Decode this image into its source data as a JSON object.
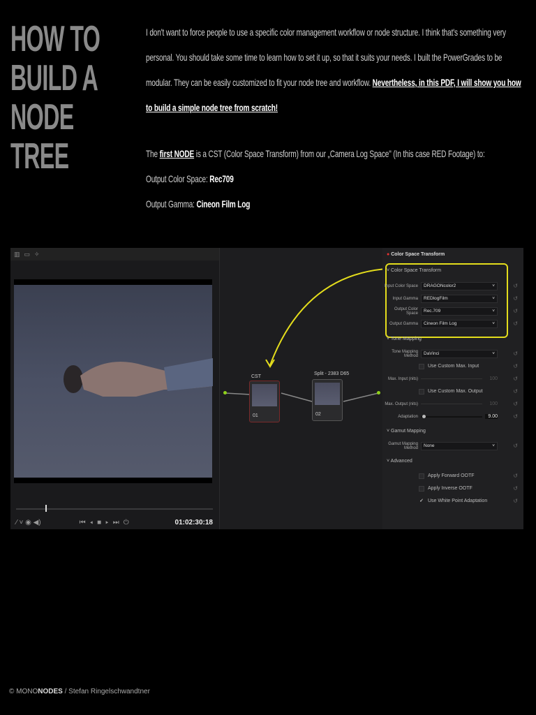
{
  "title": {
    "line1": "HOW TO BUILD A",
    "line2": "NODE TREE"
  },
  "intro": {
    "text": "I don't want to force people to use a specific color management workflow or node structure. I think that's something very personal. You should take some time to learn how to set it up, so that it suits your needs. I built the PowerGrades to be modular. They can be easily customized to fit your node tree and workflow. ",
    "emph": "Nevertheless, in this PDF, I will show you how to build a simple node tree from scratch!"
  },
  "cst": {
    "pre": "The ",
    "link": "first NODE",
    "post": " is a CST (Color Space Transform) from our „Camera Log Space\" (In this case RED Footage) to:",
    "ocs_label": "Output Color Space: ",
    "ocs_value": "Rec709",
    "og_label": "Output Gamma: ",
    "og_value": "Cineon Film Log"
  },
  "viewer": {
    "timecode": "01:02:30:18",
    "playhead": 0.15
  },
  "nodes": [
    {
      "title": "CST",
      "label": "01"
    },
    {
      "title": "Split - 2383 D65",
      "label": "02"
    }
  ],
  "inspector": {
    "header": "Color Space Transform",
    "sections": {
      "cst": "Color Space Transform",
      "tone": "Tone Mapping",
      "gamut": "Gamut Mapping",
      "adv": "Advanced"
    },
    "fields": [
      {
        "label": "Input Color Space",
        "value": "DRAGONcolor2"
      },
      {
        "label": "Input Gamma",
        "value": "REDlogFilm"
      },
      {
        "label": "Output Color Space",
        "value": "Rec.709"
      },
      {
        "label": "Output Gamma",
        "value": "Cineon Film Log"
      }
    ],
    "tone_method_label": "Tone Mapping Method",
    "tone_method": "DaVinci",
    "custom_in": "Use Custom Max. Input",
    "max_in_label": "Max. Input (nits)",
    "max_in": "100",
    "custom_out": "Use Custom Max. Output",
    "max_out_label": "Max. Output (nits)",
    "max_out": "100",
    "adapt_label": "Adaptation",
    "adapt": "9.00",
    "gamut_label": "Gamut Mapping Method",
    "gamut": "None",
    "fwd": "Apply Forward OOTF",
    "inv": "Apply Inverse OOTF",
    "wpa": "Use White Point Adaptation",
    "wpa_checked": true,
    "highlight_color": "#e4dd1c"
  },
  "footer": {
    "pre": "© MONO",
    "bold": "NODES",
    "post": " / Stefan Ringelschwandtner"
  }
}
